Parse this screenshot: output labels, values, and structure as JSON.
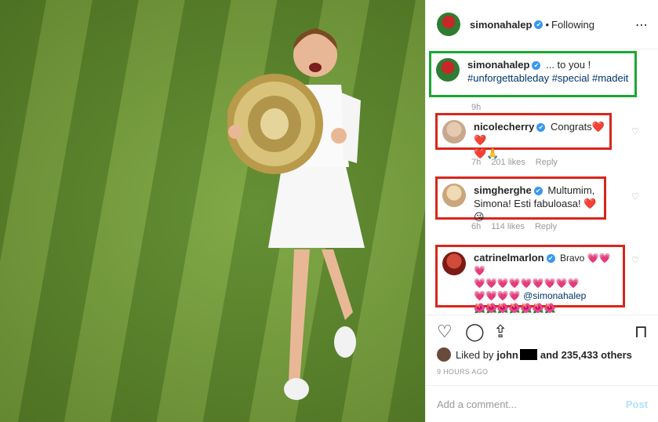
{
  "header": {
    "username": "simonahalep",
    "verified_mark": "✔",
    "separator": "•",
    "follow_state": "Following",
    "more_icon": "more-dots-icon"
  },
  "caption": {
    "username": "simonahalep",
    "text": "... to you !",
    "hashtags": "#unforgettableday #special #madeit",
    "age": "9h"
  },
  "comments": [
    {
      "username": "nicolecherry",
      "text": "Congrats",
      "emoji_line1": "❤️❤️",
      "emoji_line2": "❤️🙏",
      "age": "7h",
      "likes": "201 likes",
      "reply": "Reply"
    },
    {
      "username": "simgherghe",
      "text_line1": "Multumim,",
      "text_line2": "Simona! Esti fabuloasa!",
      "emoji": "❤️😘",
      "age": "6h",
      "likes": "114 likes",
      "reply": "Reply"
    },
    {
      "username": "catrinelmarlon",
      "text": "Bravo",
      "emoji_line1": "💗💗💗",
      "emoji_line2": "💗💗💗💗💗💗💗💗💗",
      "emoji_line3": "💗💗💗💗",
      "mention": "@simonahalep",
      "emoji_line4": "🌺🌺🌺🌺🌺🌺🌺"
    }
  ],
  "likes": {
    "prefix": "Liked by",
    "user": "john",
    "suffix": "and 235,433 others"
  },
  "timestamp": "9 HOURS AGO",
  "add_comment": {
    "placeholder": "Add a comment...",
    "post_label": "Post"
  },
  "colors": {
    "highlight_green": "#1aa832",
    "highlight_red": "#d9261c",
    "verified_blue": "#3897f0",
    "post_disabled": "#b2dffc"
  }
}
